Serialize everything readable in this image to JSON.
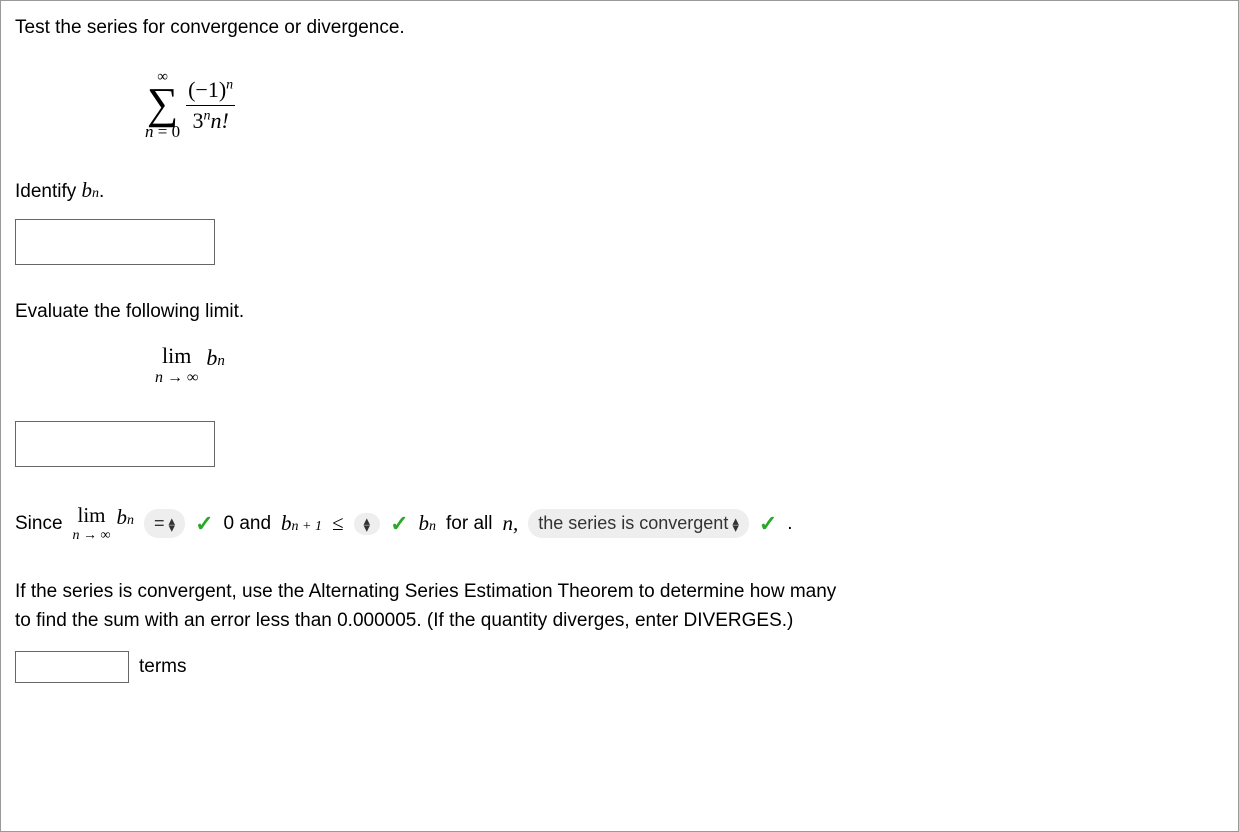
{
  "prompt": "Test the series for convergence or divergence.",
  "series": {
    "infinity": "∞",
    "sigma": "∑",
    "n_eq": "n",
    "equals": " = ",
    "zero": "0",
    "neg1": "(−1)",
    "exp_n": "n",
    "three": "3",
    "factorial": "n!"
  },
  "identify": {
    "label_pre": "Identify ",
    "b": "b",
    "n": "n",
    "dot": "."
  },
  "evaluate": {
    "label": "Evaluate the following limit.",
    "lim": "lim",
    "n": "n",
    "arrow": " → ",
    "inf": "∞",
    "b": "b",
    "bn_sub": "n"
  },
  "since": {
    "since": "Since",
    "lim": "lim",
    "n": "n",
    "arrow": " → ",
    "inf": "∞",
    "b": "b",
    "bn_sub": "n",
    "select1_label": "=",
    "select1_value": "=",
    "zero_and": " 0 and ",
    "b2": "b",
    "n1": "n + 1",
    "leq": "≤",
    "select2_value": "",
    "b3": "b",
    "n3": "n",
    "for_all": " for all ",
    "n_comma": "n,",
    "select3_value": "the series is convergent",
    "period": "."
  },
  "final": {
    "p1": "If the series is convergent, use the Alternating Series Estimation Theorem to determine how many",
    "p2": "to find the sum with an error less than 0.000005. (If the quantity diverges, enter DIVERGES.)",
    "terms": "terms"
  }
}
